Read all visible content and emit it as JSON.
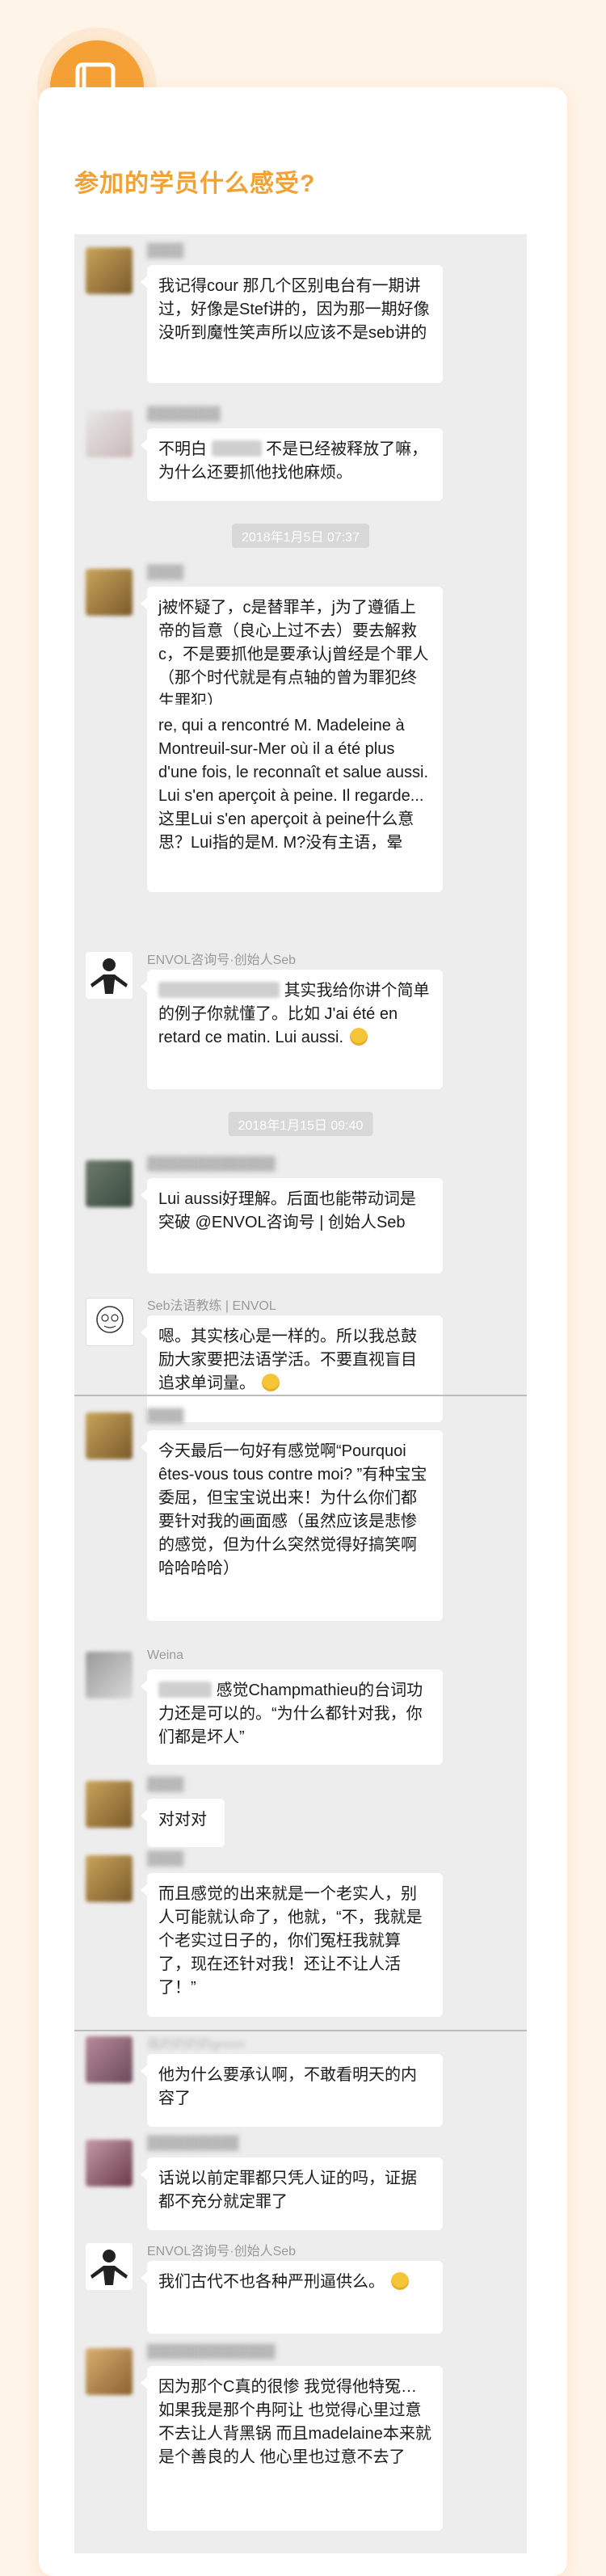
{
  "section": {
    "title": "参加的学员什么感受?",
    "icon": "book-icon"
  },
  "colors": {
    "accent": "#F5A035",
    "title": "#F2A234",
    "chat_bg": "#EDEDED",
    "page_bg": "#FFF4E8"
  },
  "timestamps": {
    "t1": "2018年1月5日 07:37",
    "t2": "2018年1月15日 09:40"
  },
  "messages": {
    "m1": {
      "text": "我记得cour 那几个区别电台有一期讲过，好像是Stef讲的，因为那一期好像没听到魔性笑声所以应该不是seb讲的"
    },
    "m2": {
      "text_a": "不明白",
      "text_b": "不是已经被释放了嘛，为什么还要抓他找他麻烦。"
    },
    "m3": {
      "text": "j被怀疑了，c是替罪羊，j为了遵循上帝的旨意（良心上过不去）要去解救c，不是要抓他是要承认j曾经是个罪人（那个时代就是有点轴的曾为罪犯终生罪犯）"
    },
    "m4": {
      "text": "re, qui a rencontré M. Madeleine à Montreuil-sur-Mer où il a été plus d'une fois, le reconnaît et salue aussi. Lui s'en aperçoit à peine. Il regarde...这里Lui s'en aperçoit à peine什么意思？Lui指的是M. M?没有主语，晕"
    },
    "m5": {
      "sender": "ENVOL咨询号·创始人Seb",
      "text": "其实我给你讲个简单的例子你就懂了。比如 J'ai été en retard ce matin. Lui aussi."
    },
    "m6": {
      "text": "Lui aussi好理解。后面也能带动词是突破 @ENVOL咨询号 | 创始人Seb"
    },
    "m7": {
      "sender": "Seb法语教练 | ENVOL",
      "text": "嗯。其实核心是一样的。所以我总鼓励大家要把法语学活。不要直视盲目追求单词量。"
    },
    "m8": {
      "text": "今天最后一句好有感觉啊“Pourquoi êtes-vous tous contre moi? ”有种宝宝委屈，但宝宝说出来！为什么你们都要针对我的画面感（虽然应该是悲惨的感觉，但为什么突然觉得好搞笑啊哈哈哈哈）"
    },
    "m9": {
      "sender": "Weina",
      "text": "感觉Champmathieu的台词功力还是可以的。“为什么都针对我，你们都是坏人”"
    },
    "m10": {
      "text": "对对对"
    },
    "m11": {
      "text": "而且感觉的出来就是一个老实人，别人可能就认命了，他就，“不，我就是个老实过日子的，你们冤枉我就算了，现在还针对我！还让不让人活了！”"
    },
    "m12": {
      "sender": "我的的的的green",
      "text": "他为什么要承认啊，不敢看明天的内容了"
    },
    "m13": {
      "text": "话说以前定罪都只凭人证的吗，证据都不充分就定罪了"
    },
    "m14": {
      "sender": "ENVOL咨询号·创始人Seb",
      "text": "我们古代不也各种严刑逼供么。"
    },
    "m15": {
      "text": "因为那个C真的很惨 我觉得他特冤… 如果我是那个冉阿让 也觉得心里过意不去让人背黑锅 而且madelaine本来就是个善良的人 他心里也过意不去了"
    }
  }
}
